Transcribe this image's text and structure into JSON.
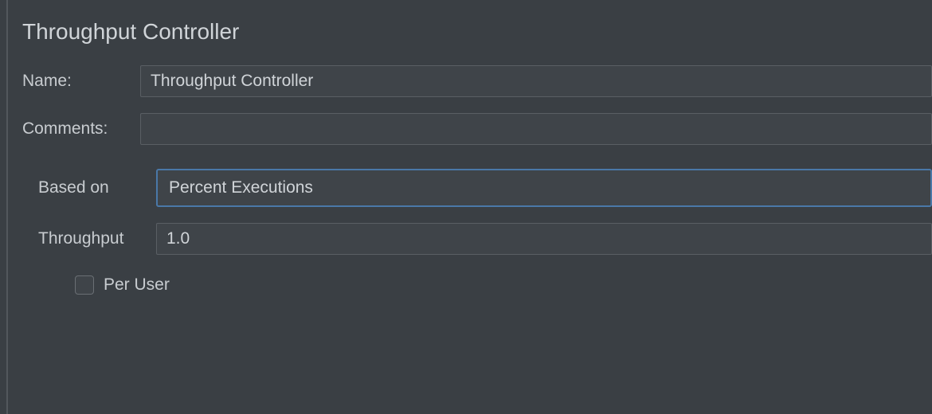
{
  "panel": {
    "title": "Throughput Controller"
  },
  "fields": {
    "name_label": "Name:",
    "name_value": "Throughput Controller",
    "comments_label": "Comments:",
    "comments_value": "",
    "based_on_label": "Based on",
    "based_on_value": "Percent Executions",
    "throughput_label": "Throughput",
    "throughput_value": "1.0",
    "per_user_label": "Per User",
    "per_user_checked": false
  }
}
